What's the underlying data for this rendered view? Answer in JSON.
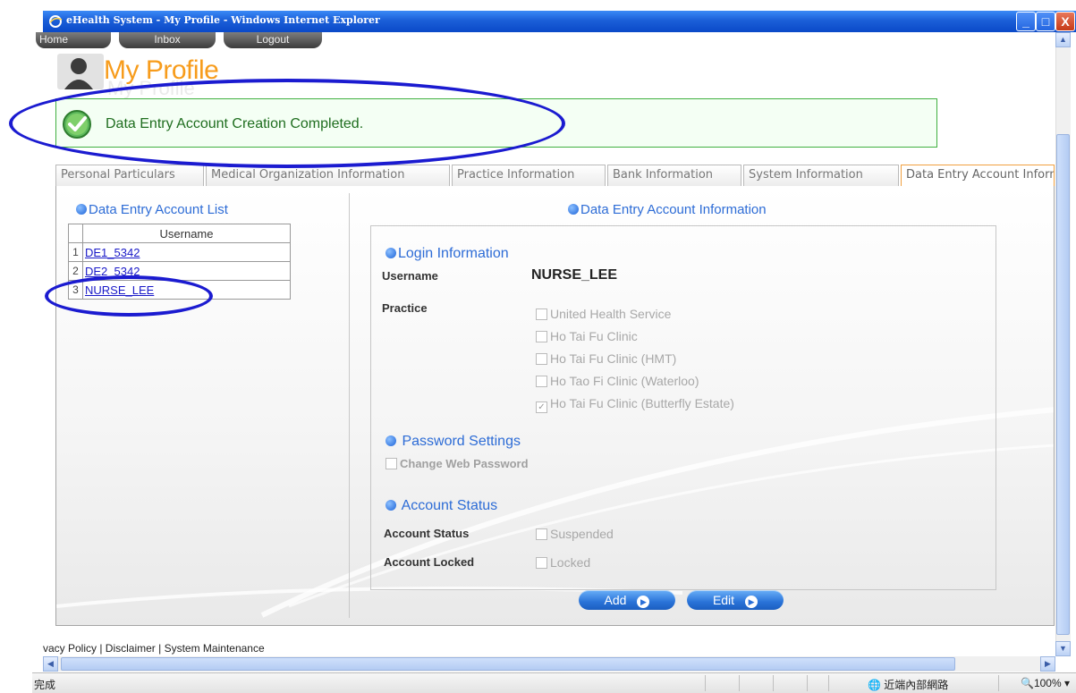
{
  "window": {
    "title": "eHealth System - My Profile - Windows Internet Explorer",
    "controls": {
      "minimize": "_",
      "maximize": "□",
      "close": "X"
    }
  },
  "nav": [
    "Home",
    "Inbox",
    "Logout"
  ],
  "page": {
    "title": "My Profile"
  },
  "message": {
    "text": "Data Entry Account Creation Completed."
  },
  "tabs": [
    {
      "label": "Personal Particulars",
      "active": false
    },
    {
      "label": "Medical Organization Information",
      "active": false
    },
    {
      "label": "Practice Information",
      "active": false
    },
    {
      "label": "Bank Information",
      "active": false
    },
    {
      "label": "System Information",
      "active": false
    },
    {
      "label": "Data Entry Account Information",
      "active": true
    }
  ],
  "account_list": {
    "heading": "Data Entry Account List",
    "column_header": "Username",
    "rows": [
      {
        "num": "1",
        "username": "DE1_5342"
      },
      {
        "num": "2",
        "username": "DE2_5342"
      },
      {
        "num": "3",
        "username": "NURSE_LEE"
      }
    ]
  },
  "account_info": {
    "heading": "Data Entry Account Information",
    "login_heading": "Login Information",
    "username_label": "Username",
    "username_value": "NURSE_LEE",
    "practice_label": "Practice",
    "practices": [
      {
        "name": "United Health Service",
        "checked": false
      },
      {
        "name": "Ho Tai Fu Clinic",
        "checked": false
      },
      {
        "name": "Ho Tai Fu Clinic (HMT)",
        "checked": false
      },
      {
        "name": "Ho Tao Fi Clinic (Waterloo)",
        "checked": false
      },
      {
        "name": "Ho Tai Fu Clinic (Butterfly Estate)",
        "checked": true
      }
    ],
    "password_heading": "Password Settings",
    "change_password_label": "Change Web Password",
    "status_heading": "Account Status",
    "account_status_label": "Account Status",
    "suspended_label": "Suspended",
    "account_locked_label": "Account Locked",
    "locked_label": "Locked"
  },
  "buttons": {
    "add": "Add",
    "edit": "Edit"
  },
  "footer": "vacy Policy | Disclaimer | System Maintenance",
  "statusbar": {
    "status": "完成",
    "zone": "近端內部網路",
    "zoom": "100%"
  },
  "colors": {
    "accent": "#2d6cd6",
    "title": "#f79c1c",
    "success": "#1f6e1f",
    "annotation": "#1b1bd0"
  }
}
